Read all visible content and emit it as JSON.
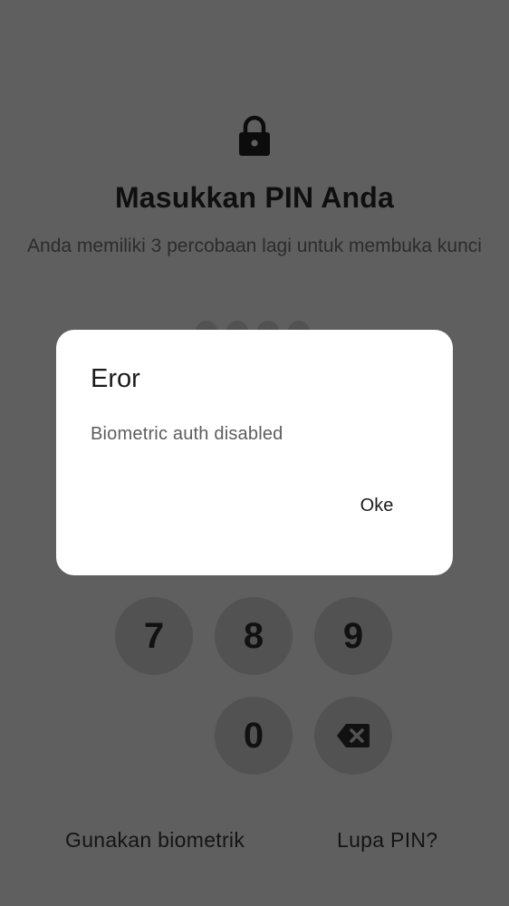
{
  "lock_screen": {
    "lock_icon": "lock-icon",
    "title": "Masukkan PIN Anda",
    "subtitle": "Anda memiliki 3 percobaan lagi untuk membuka kunci",
    "pin_length": 4,
    "keypad": {
      "keys": [
        "7",
        "8",
        "9",
        "0"
      ],
      "backspace_icon": "backspace-icon"
    },
    "biometric_link": "Gunakan biometrik",
    "forgot_pin_link": "Lupa PIN?"
  },
  "dialog": {
    "title": "Eror",
    "message": "Biometric auth disabled",
    "ok_button": "Oke"
  },
  "colors": {
    "scrim": "#5f5f5f",
    "dialog_background": "#ffffff",
    "key_background": "#525252"
  }
}
